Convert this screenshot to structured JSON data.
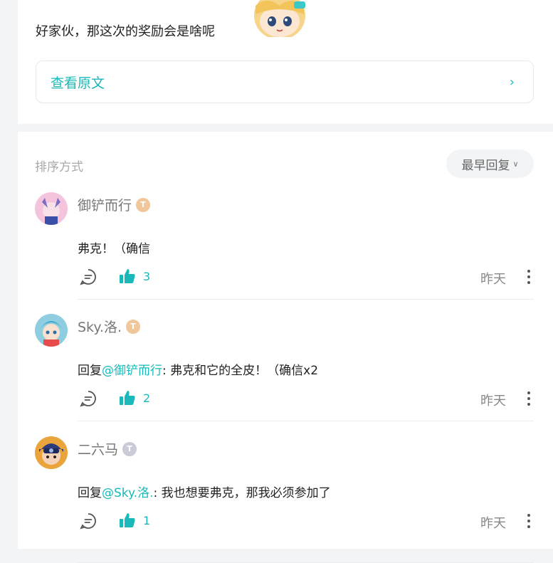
{
  "post": {
    "text": "好家伙，那这次的奖励会是啥呢",
    "view_original": "查看原文"
  },
  "sort": {
    "label": "排序方式",
    "selected": "最早回复"
  },
  "comments": [
    {
      "username": "御铲而行",
      "badge": "T",
      "badge_color": "#f0c79a",
      "reply_prefix": "",
      "mention": "",
      "text": "弗克！（确信",
      "likes": "3",
      "time": "昨天"
    },
    {
      "username": "Sky.洛.",
      "badge": "T",
      "badge_color": "#f0c79a",
      "reply_prefix": "回复",
      "mention": "@御铲而行",
      "text": ": 弗克和它的全皮！（确信x2",
      "likes": "2",
      "time": "昨天"
    },
    {
      "username": "二六马",
      "badge": "T",
      "badge_color": "#c9ccd6",
      "reply_prefix": "回复",
      "mention": "@Sky.洛.",
      "text": ": 我也想要弗克，那我必须参加了",
      "likes": "1",
      "time": "昨天"
    }
  ],
  "colors": {
    "accent": "#1ab8b8",
    "background": "#f3f4f6"
  }
}
